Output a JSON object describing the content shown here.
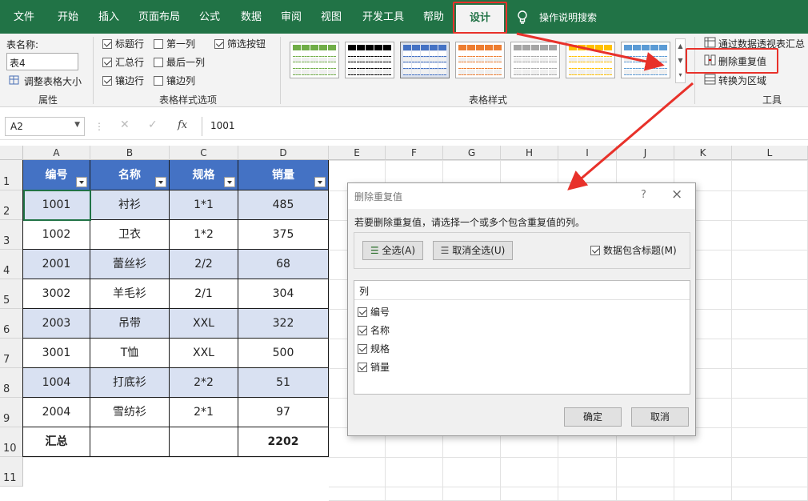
{
  "tabs": [
    "文件",
    "开始",
    "插入",
    "页面布局",
    "公式",
    "数据",
    "审阅",
    "视图",
    "开发工具",
    "帮助",
    "设计"
  ],
  "search_label": "操作说明搜索",
  "properties": {
    "name_label": "表名称:",
    "name_value": "表4",
    "resize_label": "调整表格大小",
    "group_label": "属性"
  },
  "style_options": {
    "items": [
      {
        "label": "标题行",
        "checked": true
      },
      {
        "label": "第一列",
        "checked": false
      },
      {
        "label": "筛选按钮",
        "checked": true
      },
      {
        "label": "汇总行",
        "checked": true
      },
      {
        "label": "最后一列",
        "checked": false
      },
      {
        "label": "镶边行",
        "checked": true
      },
      {
        "label": "镶边列",
        "checked": false
      }
    ],
    "group_label": "表格样式选项"
  },
  "table_styles": {
    "group_label": "表格样式",
    "colors": [
      "#70ad47",
      "#000000",
      "#4472c4",
      "#ed7d31",
      "#a5a5a5",
      "#ffc000",
      "#5b9bd5"
    ]
  },
  "tools": {
    "pivot": "通过数据透视表汇总",
    "remove_dup": "删除重复值",
    "convert": "转换为区域",
    "group_label": "工具"
  },
  "formula": {
    "name_box": "A2",
    "fx": "fx",
    "value": "1001"
  },
  "columns": [
    "A",
    "B",
    "C",
    "D",
    "E",
    "F",
    "G",
    "H",
    "I",
    "J",
    "K",
    "L"
  ],
  "rows": [
    "1",
    "2",
    "3",
    "4",
    "5",
    "6",
    "7",
    "8",
    "9",
    "10",
    "11"
  ],
  "table": {
    "headers": [
      "编号",
      "名称",
      "规格",
      "销量"
    ],
    "data": [
      [
        "1001",
        "衬衫",
        "1*1",
        "485"
      ],
      [
        "1002",
        "卫衣",
        "1*2",
        "375"
      ],
      [
        "2001",
        "蕾丝衫",
        "2/2",
        "68"
      ],
      [
        "3002",
        "羊毛衫",
        "2/1",
        "304"
      ],
      [
        "2003",
        "吊带",
        "XXL",
        "322"
      ],
      [
        "3001",
        "T恤",
        "XXL",
        "500"
      ],
      [
        "1004",
        "打底衫",
        "2*2",
        "51"
      ],
      [
        "2004",
        "雪纺衫",
        "2*1",
        "97"
      ]
    ],
    "total_label": "汇总",
    "total_value": "2202"
  },
  "dialog": {
    "title": "删除重复值",
    "help": "?",
    "close": "×",
    "prompt": "若要删除重复值，请选择一个或多个包含重复值的列。",
    "select_all": "全选(A)",
    "unselect_all": "取消全选(U)",
    "has_header": "数据包含标题(M)",
    "list_header": "列",
    "columns": [
      "编号",
      "名称",
      "规格",
      "销量"
    ],
    "ok": "确定",
    "cancel": "取消"
  }
}
